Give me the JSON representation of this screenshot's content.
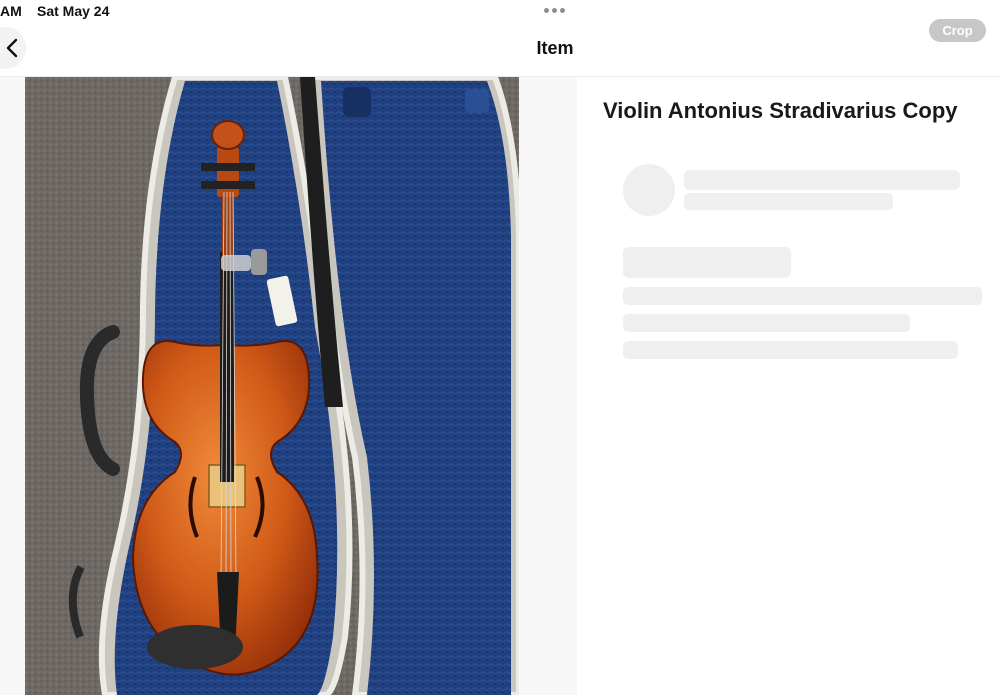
{
  "status_bar": {
    "time": "AM",
    "date": "Sat May 24"
  },
  "nav": {
    "title": "Item",
    "crop_label": "Crop",
    "back_icon": "chevron-left-icon",
    "multitask_icon": "more-dots-icon"
  },
  "item": {
    "title": "Violin Antonius Stradivarius Copy",
    "photo_description_icon": "violin-in-blue-case-photo"
  },
  "colors": {
    "accent_disabled": "#c7c7c7",
    "skeleton": "#efefef",
    "case_blue": "#1f3f7e"
  }
}
